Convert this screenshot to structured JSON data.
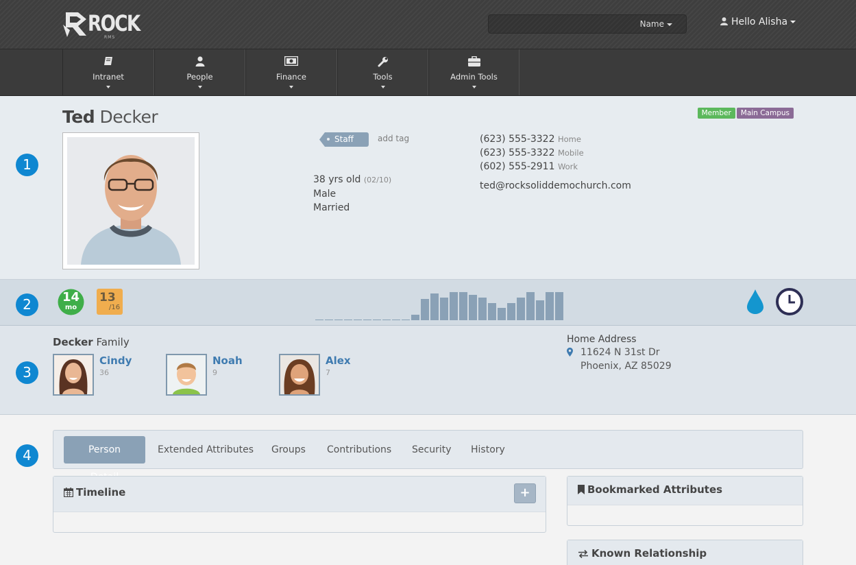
{
  "header": {
    "logo_text": "ROCK",
    "logo_sub": "RMS",
    "search": {
      "filter_label": "Name"
    },
    "user_greeting": "Hello Alisha"
  },
  "nav": [
    {
      "label": "Intranet",
      "icon": "book-icon"
    },
    {
      "label": "People",
      "icon": "user-icon"
    },
    {
      "label": "Finance",
      "icon": "money-icon"
    },
    {
      "label": "Tools",
      "icon": "wrench-icon"
    },
    {
      "label": "Admin Tools",
      "icon": "briefcase-icon"
    }
  ],
  "steps": [
    "1",
    "2",
    "3",
    "4"
  ],
  "person": {
    "first_name": "Ted",
    "last_name": "Decker",
    "badges": [
      {
        "label": "Member",
        "color": "#5cb85c"
      },
      {
        "label": "Main Campus",
        "color": "#8b6b96"
      }
    ],
    "tag": "Staff",
    "add_tag": "add tag",
    "age": "38 yrs old",
    "birthdate": "(02/10)",
    "gender": "Male",
    "marital_status": "Married",
    "phones": [
      {
        "number": "(623) 555-3322",
        "type": "Home"
      },
      {
        "number": "(623) 555-3322",
        "type": "Mobile"
      },
      {
        "number": "(602) 555-2911",
        "type": "Work"
      }
    ],
    "email": "ted@rocksoliddemochurch.com"
  },
  "badge_bar": {
    "membership": {
      "value": "14",
      "unit": "mo",
      "color": "#3fae49"
    },
    "attendance": {
      "value": "13",
      "of": "/16",
      "color": "#f0ad4e"
    },
    "attendance_bars": [
      0,
      0,
      0,
      0,
      0,
      0,
      0,
      0,
      0,
      0,
      0.2,
      0.75,
      0.95,
      0.8,
      1.0,
      1.0,
      0.9,
      0.8,
      0.6,
      0.45,
      0.6,
      0.8,
      1.0,
      0.7,
      1.0,
      1.0
    ],
    "right_icons": [
      "water-drop-icon",
      "clock-icon"
    ],
    "bar_color": "#8aa1b6"
  },
  "family": {
    "name": "Decker",
    "label": "Family",
    "members": [
      {
        "name": "Cindy",
        "age": "36"
      },
      {
        "name": "Noah",
        "age": "9"
      },
      {
        "name": "Alex",
        "age": "7"
      }
    ],
    "address_title": "Home Address",
    "address_line1": "11624 N 31st Dr",
    "address_line2": "Phoenix, AZ 85029"
  },
  "tabs": [
    "Person Detail",
    "Extended Attributes",
    "Groups",
    "Contributions",
    "Security",
    "History"
  ],
  "active_tab": "Person Detail",
  "panels": {
    "timeline": "Timeline",
    "bookmarked": "Bookmarked Attributes",
    "known_relationship": "Known Relationship"
  }
}
